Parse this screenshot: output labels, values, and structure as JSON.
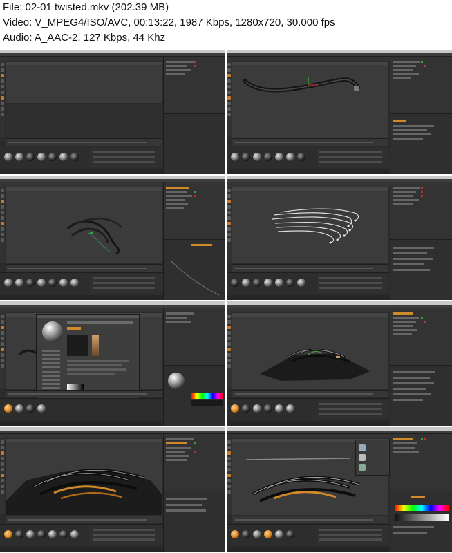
{
  "header": {
    "file_line": "File: 02-01 twisted.mkv (202.39 MB)",
    "video_line": "Video: V_MPEG4/ISO/AVC, 00:13:22, 1987 Kbps, 1280x720, 30.000 fps",
    "audio_line": "Audio: A_AAC-2, 127 Kbps, 44 Khz"
  },
  "thumbnails": [
    {
      "scene": "empty-viewport"
    },
    {
      "scene": "single-tube"
    },
    {
      "scene": "twisted-cables"
    },
    {
      "scene": "bundle-strands"
    },
    {
      "scene": "material-editor"
    },
    {
      "scene": "cables-on-terrain"
    },
    {
      "scene": "terrain-closeup"
    },
    {
      "scene": "final-render-settings"
    }
  ],
  "colors": {
    "ui_dark": "#2b2b2b",
    "viewport": "#3b3b3b",
    "accent_orange": "#d08a2a",
    "cable": "#1a1a1a"
  }
}
